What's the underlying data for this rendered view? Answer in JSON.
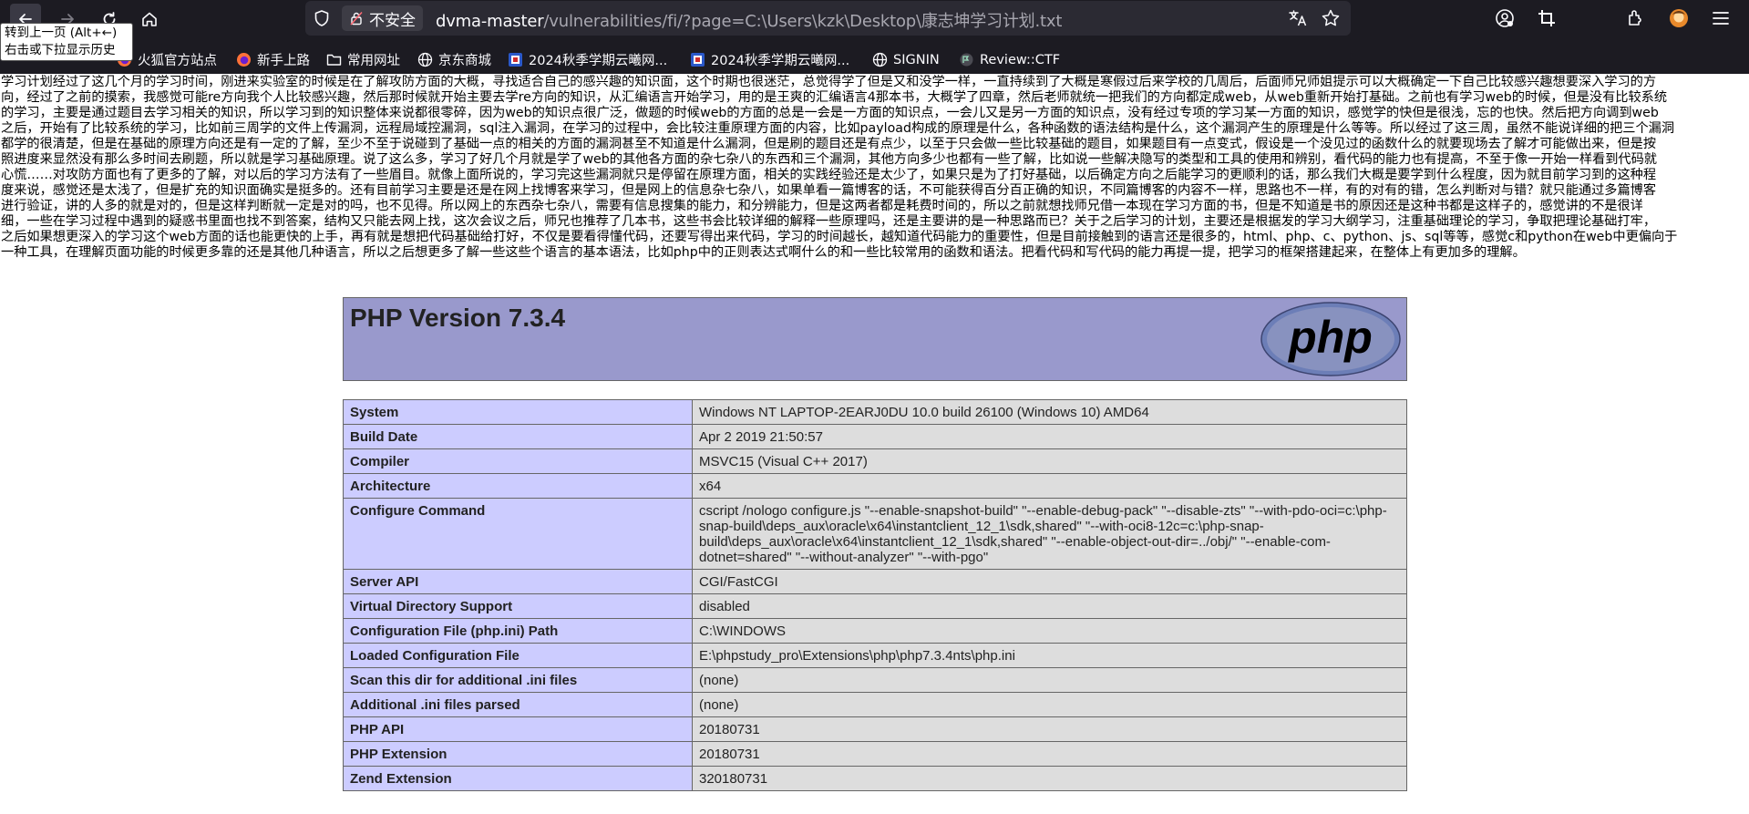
{
  "browser": {
    "tooltip_line1": "转到上一页 (Alt+←)",
    "tooltip_line2": "右击或下拉显示历史",
    "not_secure_label": "不安全",
    "url_host": "dvma-master",
    "url_path": "/vulnerabilities/fi/?page=C:\\Users\\kzk\\Desktop\\康志坤学习计划.txt",
    "bookmarks": [
      {
        "label": "火狐官方站点",
        "icon": "firefox-icon"
      },
      {
        "label": "新手上路",
        "icon": "firefox-icon"
      },
      {
        "label": "常用网址",
        "icon": "folder-icon"
      },
      {
        "label": "京东商城",
        "icon": "globe-icon"
      },
      {
        "label": "2024秋季学期云曦网...",
        "icon": "site-icon"
      },
      {
        "label": "2024秋季学期云曦网...",
        "icon": "site-icon"
      },
      {
        "label": "SIGNIN",
        "icon": "globe-icon"
      },
      {
        "label": "Review::CTF",
        "icon": "ctf-icon"
      }
    ]
  },
  "essay_lines": [
    "学习计划经过了这几个月的学习时间，刚进来实验室的时候是在了解攻防方面的大概，寻找适合自己的感兴趣的知识面，这个时期也很迷茫，总觉得学了但是又和没学一样，一直持续到了大概是寒假过后来学校的几周后，后面师兄师姐提示可以大概确定一下自己比较感兴趣想要深入学习的方",
    "向，经过了之前的摸索，我感觉可能re方向我个人比较感兴趣，然后那时候就开始主要去学re方向的知识，从汇编语言开始学习，用的是王爽的汇编语言4那本书，大概学了四章，然后老师就统一把我们的方向都定成web，从web重新开始打基础。之前也有学习web的时候，但是没有比较系统",
    "的学习，主要是通过题目去学习相关的知识，所以学习到的知识整体来说都很零碎，因为web的知识点很广泛，做题的时候web的方面的总是一会是一方面的知识点，一会儿又是另一方面的知识点，没有经过专项的学习某一方面的知识，感觉学的快但是很浅，忘的也快。然后把方向调到web",
    "之后，开始有了比较系统的学习，比如前三周学的文件上传漏洞，远程局域控漏洞，sql注入漏洞，在学习的过程中，会比较注重原理方面的内容，比如payload构成的原理是什么，各种函数的语法结构是什么，这个漏洞产生的原理是什么等等。所以经过了这三周，虽然不能说详细的把三个漏洞",
    "都学的很清楚，但是在基础的原理方向还是有一定的了解，至少不至于说碰到了基础一点的相关的方面的漏洞甚至不知道是什么漏洞，但是刷的题目还是有点少，以至于只会做一些比较基础的题目，如果题目有一点变式，假设是一个没见过的函数什么的就要现场去了解才可能做出来，但是按",
    "照进度来显然没有那么多时间去刷题，所以就是学习基础原理。说了这么多，学习了好几个月就是学了web的其他各方面的杂七杂八的东西和三个漏洞，其他方向多少也都有一些了解，比如说一些解决隐写的类型和工具的使用和辨别，看代码的能力也有提高，不至于像一开始一样看到代码就",
    "心慌……对攻防方面也有了更多的了解，对以后的学习方法有了一些眉目。就像上面所说的，学习完这些漏洞就只是停留在原理方面，相关的实践经验还是太少了，如果只是为了打好基础，以后确定方向之后能学习的更顺利的话，那么我们大概是要学到什么程度，因为就目前学习到的这种程",
    "度来说，感觉还是太浅了，但是扩充的知识面确实是挺多的。还有目前学习主要是还是在网上找博客来学习，但是网上的信息杂七杂八，如果单看一篇博客的话，不可能获得百分百正确的知识，不同篇博客的内容不一样，思路也不一样，有的对有的错，怎么判断对与错？就只能通过多篇博客",
    "进行验证，讲的人多的就是对的，但是这样判断就一定是对的吗，也不见得。所以网上的东西杂七杂八，需要有信息搜集的能力，和分辨能力，但是这两者都是耗费时间的，所以之前就想找师兄借一本现在学习方面的书，但是不知道是书的原因还是这种书都是这样子的，感觉讲的不是很详",
    "细，一些在学习过程中遇到的疑惑书里面也找不到答案，结构又只能去网上找，这次会议之后，师兄也推荐了几本书，这些书会比较详细的解释一些原理吗，还是主要讲的是一种思路而已？关于之后学习的计划，主要还是根据发的学习大纲学习，注重基础理论的学习，争取把理论基础打牢，",
    "之后如果想更深入的学习这个web方面的话也能更快的上手，再有就是想把代码基础给打好，不仅是要看得懂代码，还要写得出来代码，学习的时间越长，越知道代码能力的重要性，但是目前接触到的语言还是很多的，html、php、c、python、js、sql等等，感觉c和python在web中更偏向于",
    "一种工具，在理解页面功能的时候更多靠的还是其他几种语言，所以之后想更多了解一些这些个语言的基本语法，比如php中的正则表达式啊什么的和一些比较常用的函数和语法。把看代码和写代码的能力再提一提，把学习的框架搭建起来，在整体上有更加多的理解。"
  ],
  "phpinfo": {
    "title": "PHP Version 7.3.4",
    "logo_text": "php",
    "rows": [
      {
        "key": "System",
        "value": "Windows NT LAPTOP-2EARJ0DU 10.0 build 26100 (Windows 10) AMD64"
      },
      {
        "key": "Build Date",
        "value": "Apr 2 2019 21:50:57"
      },
      {
        "key": "Compiler",
        "value": "MSVC15 (Visual C++ 2017)"
      },
      {
        "key": "Architecture",
        "value": "x64"
      },
      {
        "key": "Configure Command",
        "value_lines": [
          "cscript /nologo configure.js \"--enable-snapshot-build\" \"--enable-debug-pack\" \"--disable-zts\" \"--with-pdo-oci=c:\\php-",
          "snap-build\\deps_aux\\oracle\\x64\\instantclient_12_1\\sdk,shared\" \"--with-oci8-12c=c:\\php-snap-",
          "build\\deps_aux\\oracle\\x64\\instantclient_12_1\\sdk,shared\" \"--enable-object-out-dir=../obj/\" \"--enable-com-",
          "dotnet=shared\" \"--without-analyzer\" \"--with-pgo\""
        ]
      },
      {
        "key": "Server API",
        "value": "CGI/FastCGI"
      },
      {
        "key": "Virtual Directory Support",
        "value": "disabled"
      },
      {
        "key": "Configuration File (php.ini) Path",
        "value": "C:\\WINDOWS"
      },
      {
        "key": "Loaded Configuration File",
        "value": "E:\\phpstudy_pro\\Extensions\\php\\php7.3.4nts\\php.ini"
      },
      {
        "key": "Scan this dir for additional .ini files",
        "value": "(none)"
      },
      {
        "key": "Additional .ini files parsed",
        "value": "(none)"
      },
      {
        "key": "PHP API",
        "value": "20180731"
      },
      {
        "key": "PHP Extension",
        "value": "20180731"
      },
      {
        "key": "Zend Extension",
        "value": "320180731"
      }
    ]
  },
  "colors": {
    "chrome_bg": "#1c1b22",
    "urlbar_bg": "#2b2a33",
    "php_header": "#9999cc",
    "php_key": "#ccccff",
    "php_value": "#dddddd"
  }
}
